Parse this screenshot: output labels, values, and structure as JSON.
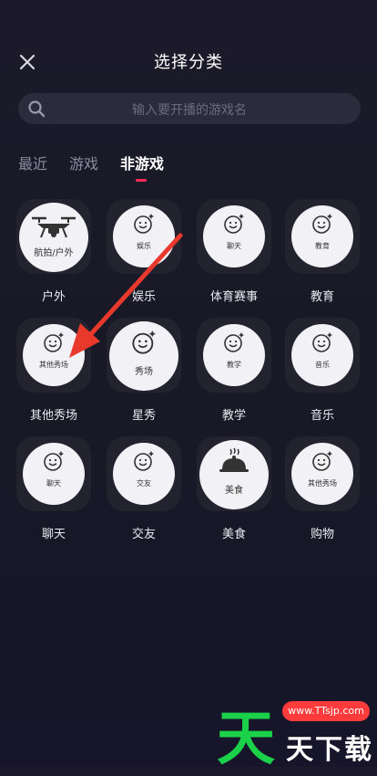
{
  "header": {
    "title": "选择分类"
  },
  "search": {
    "placeholder": "输入要开播的游戏名"
  },
  "tabs": [
    {
      "label": "最近"
    },
    {
      "label": "游戏"
    },
    {
      "label": "非游戏"
    }
  ],
  "categories": [
    {
      "icon_label": "航拍/户外",
      "name": "户外",
      "icon": "drone-icon"
    },
    {
      "icon_label": "娱乐",
      "name": "娱乐",
      "icon": "smile-icon"
    },
    {
      "icon_label": "聊天",
      "name": "体育赛事",
      "icon": "smile-icon"
    },
    {
      "icon_label": "教育",
      "name": "教育",
      "icon": "smile-icon"
    },
    {
      "icon_label": "其他秀场",
      "name": "其他秀场",
      "icon": "smile-icon"
    },
    {
      "icon_label": "秀场",
      "name": "星秀",
      "icon": "smile-icon"
    },
    {
      "icon_label": "教学",
      "name": "教学",
      "icon": "smile-icon"
    },
    {
      "icon_label": "音乐",
      "name": "音乐",
      "icon": "smile-icon"
    },
    {
      "icon_label": "聊天",
      "name": "聊天",
      "icon": "smile-icon"
    },
    {
      "icon_label": "交友",
      "name": "交友",
      "icon": "smile-icon"
    },
    {
      "icon_label": "美食",
      "name": "美食",
      "icon": "food-cover-icon"
    },
    {
      "icon_label": "其他秀场",
      "name": "购物",
      "icon": "smile-icon"
    }
  ],
  "watermark": {
    "pill": "www.TTsjp.com",
    "text": "天下载"
  },
  "colors": {
    "accent": "#fe2c55",
    "arrow": "#e8392c"
  }
}
